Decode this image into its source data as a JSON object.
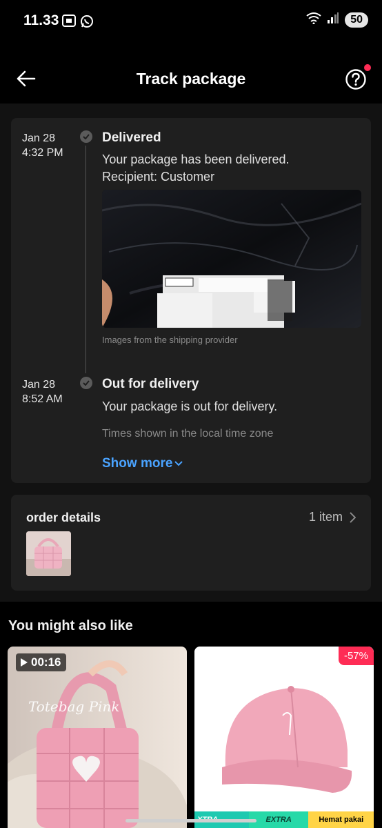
{
  "status_bar": {
    "time": "11.33",
    "battery": "50"
  },
  "header": {
    "title": "Track package"
  },
  "tracking": {
    "events": [
      {
        "date": "Jan 28",
        "time": "4:32 PM",
        "title": "Delivered",
        "description_line1": "Your package has been delivered.",
        "description_line2": "Recipient: Customer"
      },
      {
        "date": "Jan 28",
        "time": "8:52 AM",
        "title": "Out for delivery",
        "description_line1": "Your package is out for delivery."
      }
    ],
    "photo_caption": "Images from the shipping provider",
    "timezone_note": "Times shown in the local time zone",
    "show_more_label": "Show more"
  },
  "order": {
    "label": "order details",
    "item_count": "1 item"
  },
  "recommendations": {
    "title": "You might also like",
    "products": [
      {
        "video_duration": "00:16",
        "overlay_text": "Totebag Pink"
      },
      {
        "discount": "-57%",
        "promo_labels": [
          "XTRA",
          "EXTRA",
          "Hemat pakai"
        ]
      }
    ]
  },
  "colors": {
    "accent_link": "#4aa3ff",
    "discount_red": "#fe2c55",
    "card_bg": "#1f1f1f"
  }
}
